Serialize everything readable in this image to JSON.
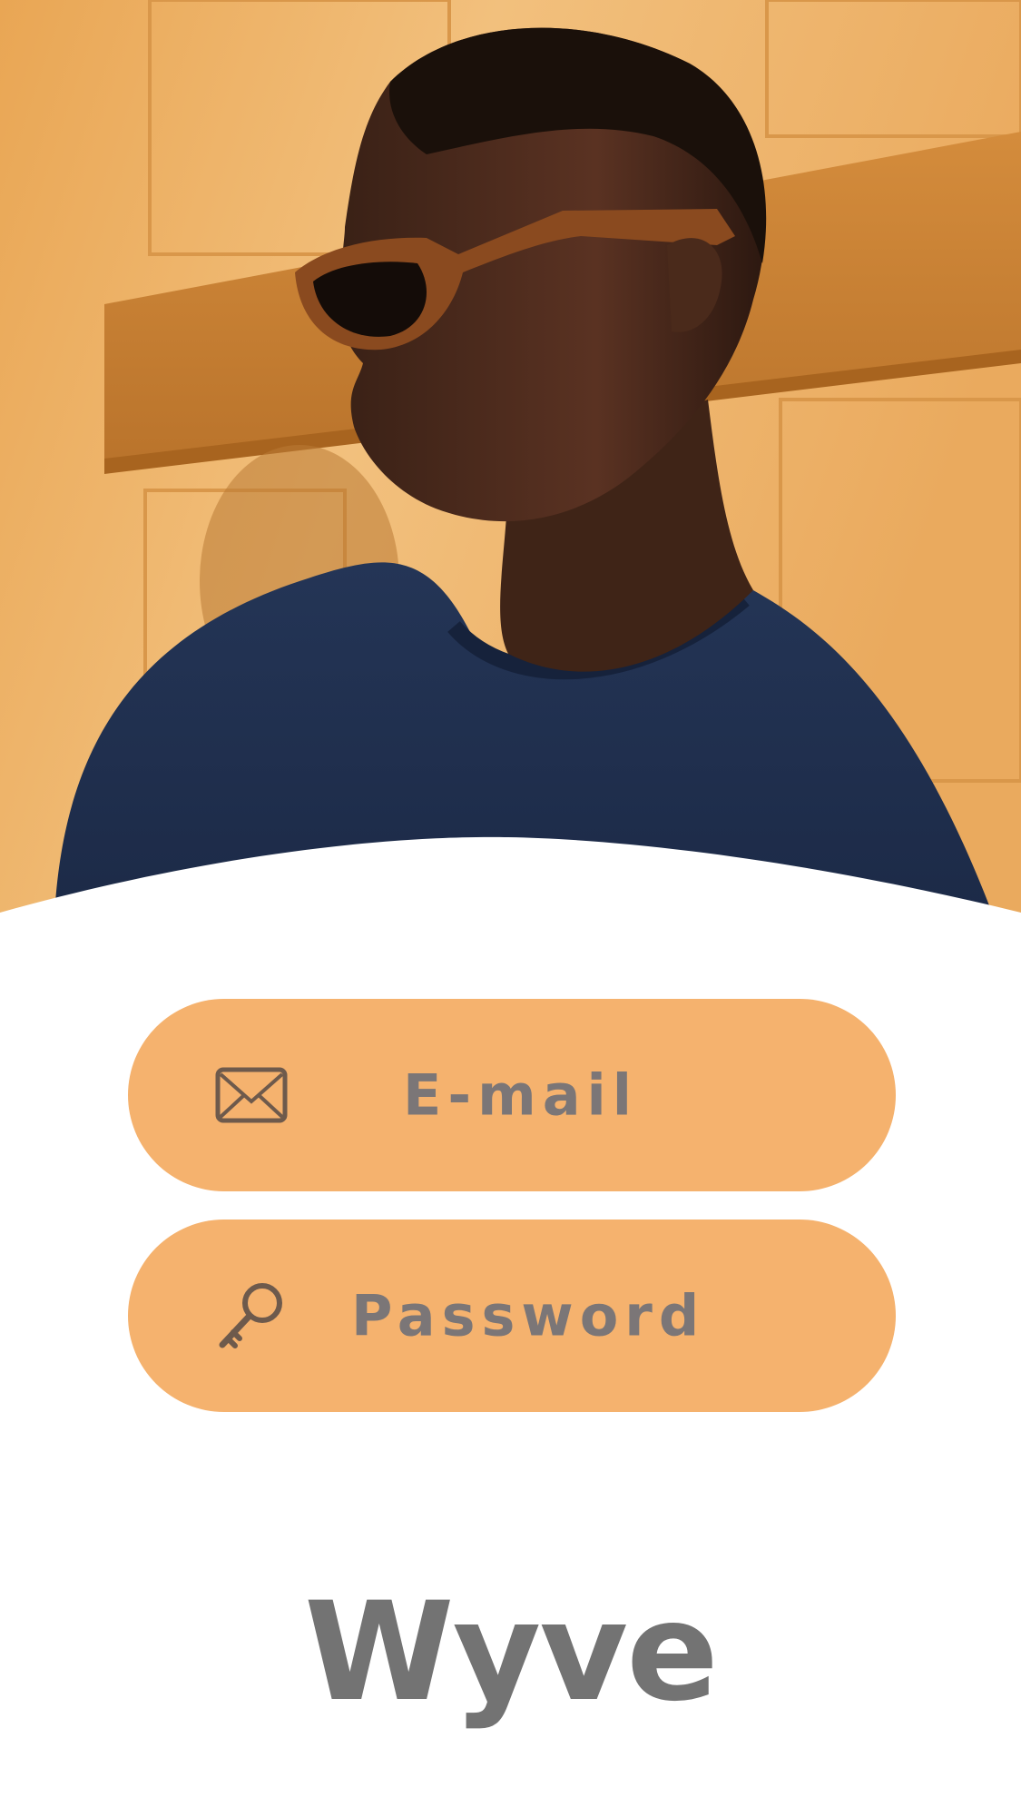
{
  "colors": {
    "field_background": "#f5b26e",
    "field_text": "#7b7677",
    "icon_stroke": "#6e5a4c",
    "brand_text": "#737373",
    "background": "#ffffff"
  },
  "hero": {
    "icon": "portrait-photo"
  },
  "form": {
    "email": {
      "placeholder": "E-mail",
      "icon": "envelope-icon"
    },
    "password": {
      "placeholder": "Password",
      "icon": "key-icon"
    }
  },
  "brand": {
    "name": "Wyve"
  }
}
